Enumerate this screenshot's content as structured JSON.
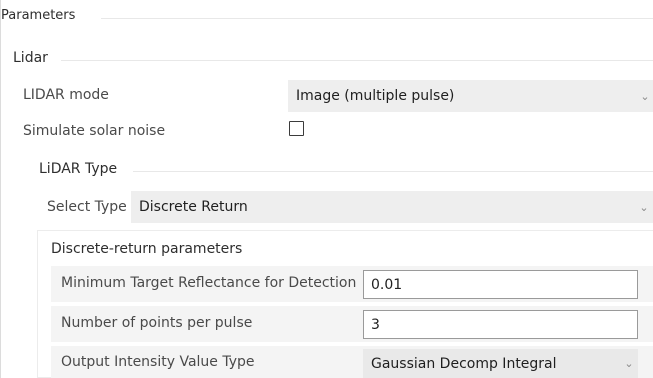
{
  "parameters": {
    "title": "Parameters"
  },
  "lidar": {
    "title": "Lidar",
    "mode_label": "LIDAR mode",
    "mode_value": "Image (multiple pulse)",
    "solar_noise_label": "Simulate solar noise",
    "solar_noise_checked": false
  },
  "lidar_type": {
    "title": "LiDAR Type",
    "select_label": "Select Type",
    "select_value": "Discrete Return"
  },
  "discrete": {
    "title": "Discrete-return parameters",
    "min_reflectance_label": "Minimum Target Reflectance for Detection",
    "min_reflectance_value": "0.01",
    "points_per_pulse_label": "Number of points per pulse",
    "points_per_pulse_value": "3",
    "intensity_label": "Output Intensity Value Type",
    "intensity_value": "Gaussian Decomp Integral"
  }
}
